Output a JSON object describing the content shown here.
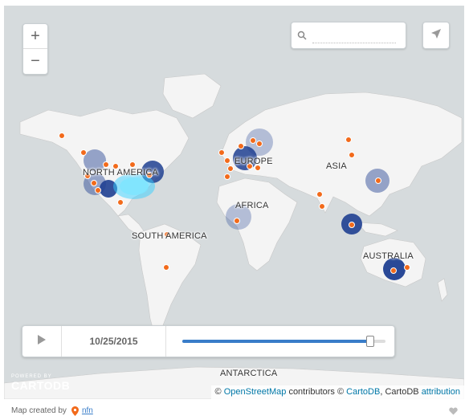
{
  "map": {
    "labels": {
      "north_america": "NORTH AMERICA",
      "europe": "EUROPE",
      "asia": "ASIA",
      "africa": "AFRICA",
      "south_america": "SOUTH AMERICA",
      "australia": "AUSTRALIA",
      "antarctica": "ANTARCTICA"
    },
    "colors": {
      "ocean": "#d6dbdd",
      "land": "#f4f4f4",
      "point": "#f26a1b",
      "cluster": "#1f3f91",
      "hotspot": "#36cfff"
    }
  },
  "controls": {
    "zoom_in": "+",
    "zoom_out": "−",
    "search_icon": "search-icon",
    "search_placeholder": "",
    "share_icon": "paper-plane-icon"
  },
  "timeline": {
    "date": "10/25/2015",
    "progress": 0.92,
    "play_icon": "play-icon"
  },
  "branding": {
    "powered_by": "POWERED BY",
    "logo_text": "CARTODB"
  },
  "attribution": {
    "copyright1": "©",
    "osm": "OpenStreetMap",
    "contributors": "contributors ©",
    "cartodb": "CartoDB",
    "comma": ", CartoDB",
    "attr_link": "attribution"
  },
  "footer": {
    "created_by": "Map created by",
    "user": "nfn",
    "pin_icon": "location-pin-icon",
    "heart_icon": "heart-icon"
  }
}
